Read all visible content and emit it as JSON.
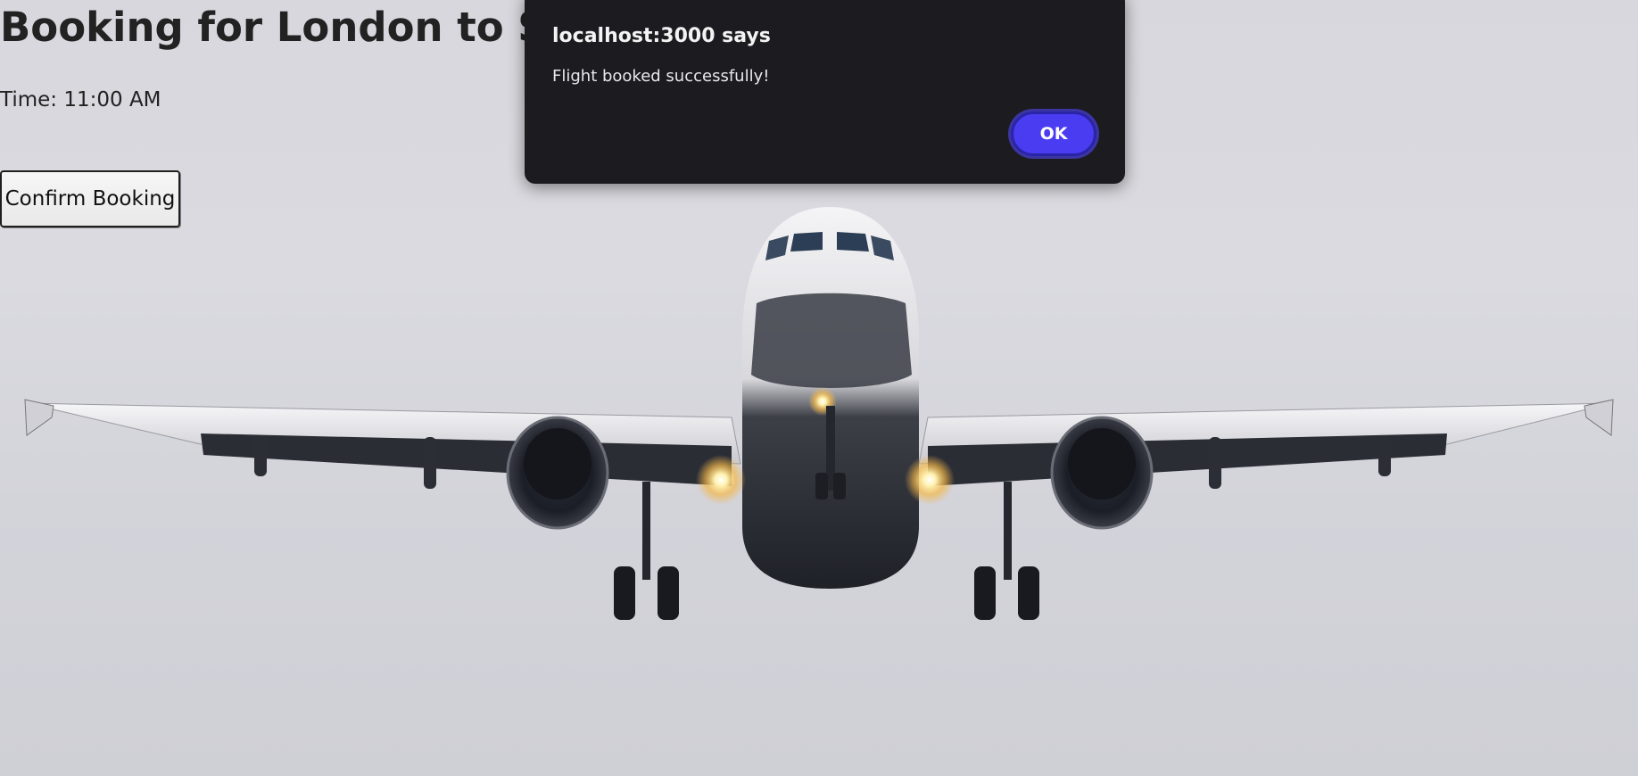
{
  "page": {
    "title": "Booking for London to Switzerland",
    "time": "Time: 11:00 AM",
    "confirm_button_label": "Confirm Booking"
  },
  "dialog": {
    "origin_title": "localhost:3000 says",
    "message": "Flight booked successfully!",
    "ok_label": "OK"
  },
  "background": {
    "image_subject": "airplane-approaching-photo"
  },
  "colors": {
    "dialog_bg": "#1c1b20",
    "ok_button": "#4a3cf0",
    "sky": "#d7d7dd"
  }
}
